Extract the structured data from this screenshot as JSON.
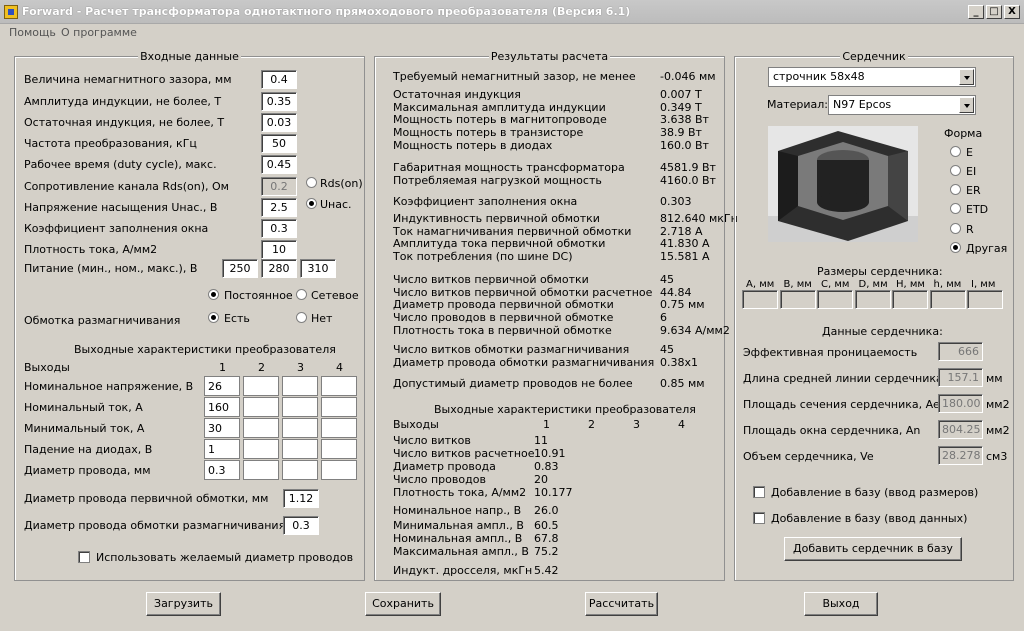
{
  "window": {
    "title": "Forward - Расчет трансформатора однотактного прямоходового преобразователя (Версия 6.1)",
    "minimize": "_",
    "maximize": "□",
    "close": "X"
  },
  "menu": [
    "Помощь",
    "О программе"
  ],
  "input": {
    "title": "Входные данные",
    "rows": [
      {
        "label": "Величина немагнитного зазора, мм",
        "value": "0.4"
      },
      {
        "label": "Амплитуда индукции, не более, Т",
        "value": "0.35"
      },
      {
        "label": "Остаточная индукция, не более, Т",
        "value": "0.03"
      },
      {
        "label": "Частота преобразования, кГц",
        "value": "50"
      },
      {
        "label": "Рабочее время (duty cycle), макс.",
        "value": "0.45"
      },
      {
        "label": "Сопротивление канала Rds(on), Ом",
        "value": "0.2"
      },
      {
        "label": "Напряжение насыщения Uнас., В",
        "value": "2.5"
      },
      {
        "label": "Коэффициент заполнения окна",
        "value": "0.3"
      },
      {
        "label": "Плотность тока, А/мм2",
        "value": "10"
      }
    ],
    "rds_option": "Rds(on)",
    "unas_option": "Uнас.",
    "supply_label": "Питание (мин., ном., макс.), В",
    "supply": [
      "250",
      "280",
      "310"
    ],
    "supply_const": "Постоянное",
    "supply_net": "Сетевое",
    "demag_label": "Обмотка размагничивания",
    "demag_yes": "Есть",
    "demag_no": "Нет",
    "out_title": "Выходные характеристики преобразователя",
    "out_header": "Выходы",
    "out_cols": [
      "1",
      "2",
      "3",
      "4"
    ],
    "out_rows": [
      {
        "label": "Номинальное напряжение, В",
        "values": [
          "26",
          "",
          "",
          ""
        ]
      },
      {
        "label": "Номинальный ток, А",
        "values": [
          "160",
          "",
          "",
          ""
        ]
      },
      {
        "label": "Минимальный ток, А",
        "values": [
          "30",
          "",
          "",
          ""
        ]
      },
      {
        "label": "Падение на диодах, В",
        "values": [
          "1",
          "",
          "",
          ""
        ]
      },
      {
        "label": "Диаметр провода, мм",
        "values": [
          "0.3",
          "",
          "",
          ""
        ]
      }
    ],
    "primary_wire_label": "Диаметр провода первичной обмотки, мм",
    "primary_wire": "1.12",
    "demag_wire_label": "Диаметр провода обмотки размагничивания, мм",
    "demag_wire": "0.3",
    "use_desired": "Использовать желаемый диаметр проводов"
  },
  "results": {
    "title": "Результаты расчета",
    "groups": [
      [
        {
          "label": "Требуемый немагнитный зазор, не менее",
          "value": "-0.046 мм"
        }
      ],
      [
        {
          "label": "Остаточная индукция",
          "value": "0.007 Т"
        },
        {
          "label": "Максимальная амплитуда индукции",
          "value": "0.349 Т"
        },
        {
          "label": "Мощность потерь в магнитопроводе",
          "value": "3.638 Вт"
        },
        {
          "label": "Мощность потерь в транзисторе",
          "value": "38.9 Вт"
        },
        {
          "label": "Мощность потерь в диодах",
          "value": "160.0 Вт"
        }
      ],
      [
        {
          "label": "Габаритная мощность трансформатора",
          "value": "4581.9 Вт"
        },
        {
          "label": "Потребляемая нагрузкой мощность",
          "value": "4160.0 Вт"
        }
      ],
      [
        {
          "label": "Коэффициент заполнения окна",
          "value": "0.303"
        }
      ],
      [
        {
          "label": "Индуктивность первичной обмотки",
          "value": "812.640 мкГн"
        },
        {
          "label": "Ток намагничивания первичной обмотки",
          "value": "2.718 А"
        },
        {
          "label": "Амплитуда тока первичной обмотки",
          "value": "41.830 А"
        },
        {
          "label": "Ток потребления (по шине DC)",
          "value": "15.581 А"
        }
      ],
      [
        {
          "label": "Число витков первичной обмотки",
          "value": "45"
        },
        {
          "label": "Число витков первичной обмотки расчетное",
          "value": "44.84"
        },
        {
          "label": "Диаметр провода первичной обмотки",
          "value": "0.75 мм"
        },
        {
          "label": "Число проводов в первичной обмотке",
          "value": "6"
        },
        {
          "label": "Плотность тока в первичной обмотке",
          "value": "9.634 А/мм2"
        }
      ],
      [
        {
          "label": "Число витков обмотки размагничивания",
          "value": "45"
        },
        {
          "label": "Диаметр провода обмотки размагничивания",
          "value": "0.38x1"
        }
      ],
      [
        {
          "label": "Допустимый диаметр проводов не более",
          "value": "0.85 мм"
        }
      ]
    ],
    "out_title": "Выходные характеристики преобразователя",
    "out_header": "Выходы",
    "out_cols": [
      "1",
      "2",
      "3",
      "4"
    ],
    "out_rows": [
      {
        "label": "Число витков",
        "value": "11"
      },
      {
        "label": "Число витков расчетное",
        "value": "10.91"
      },
      {
        "label": "Диаметр провода",
        "value": "0.83"
      },
      {
        "label": "Число проводов",
        "value": "20"
      },
      {
        "label": "Плотность тока, А/мм2",
        "value": "10.177"
      },
      {
        "label": "Номинальное напр., В",
        "value": "26.0"
      },
      {
        "label": "Минимальная ампл., В",
        "value": "60.5"
      },
      {
        "label": "Номинальная ампл., В",
        "value": "67.8"
      },
      {
        "label": "Максимальная ампл., В",
        "value": "75.2"
      },
      {
        "label": "Индукт. дросселя, мкГн",
        "value": "5.42"
      }
    ]
  },
  "core": {
    "title": "Сердечник",
    "selected": "строчник 58x48",
    "material_label": "Материал:",
    "material": "N97 Epcos",
    "shape_label": "Форма",
    "shapes": [
      "E",
      "EI",
      "ER",
      "ETD",
      "R",
      "Другая"
    ],
    "shape_selected": 5,
    "dims_title": "Размеры сердечника:",
    "dims": [
      "A, мм",
      "B, мм",
      "C, мм",
      "D, мм",
      "H, мм",
      "h, мм",
      "I, мм"
    ],
    "data_title": "Данные сердечника:",
    "params": [
      {
        "label": "Эффективная проницаемость",
        "value": "666",
        "unit": ""
      },
      {
        "label": "Длина средней линии сердечника, le",
        "value": "157.1",
        "unit": "мм"
      },
      {
        "label": "Площадь сечения сердечника, Ae",
        "value": "180.00",
        "unit": "мм2"
      },
      {
        "label": "Площадь окна сердечника, An",
        "value": "804.25",
        "unit": "мм2"
      },
      {
        "label": "Объем сердечника, Ve",
        "value": "28.278",
        "unit": "см3"
      }
    ],
    "add_dims": "Добавление в базу (ввод размеров)",
    "add_data": "Добавление в базу (ввод данных)",
    "add_button": "Добавить сердечник в базу"
  },
  "buttons": {
    "load": "Загрузить",
    "save": "Сохранить",
    "calc": "Рассчитать",
    "exit": "Выход"
  }
}
